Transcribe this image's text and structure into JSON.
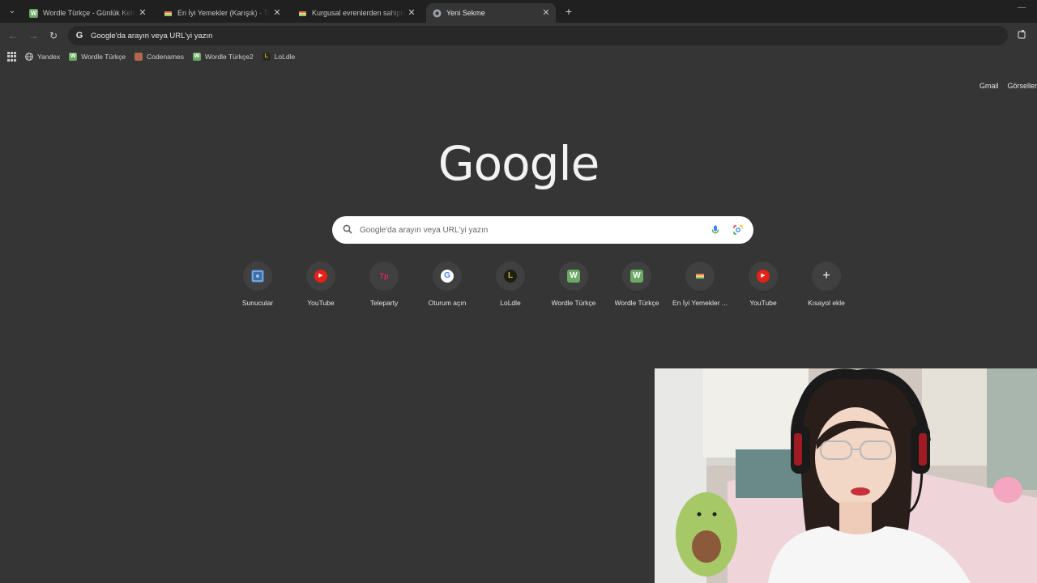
{
  "tabs": [
    {
      "title": "Wordle Türkçe - Günlük Kelime Oyunu",
      "fav": "W",
      "fav_color": "#6aaa64",
      "active": false
    },
    {
      "title": "En İyi Yemekler (Karışık) - Tier List",
      "fav": "",
      "fav_color": "#7a8a5a",
      "active": false
    },
    {
      "title": "Kurgusal evrenlerden sahiplenmek istediğiniz",
      "fav": "",
      "fav_color": "#7a8a5a",
      "active": false
    },
    {
      "title": "Yeni Sekme",
      "fav": "",
      "fav_color": "#8a8a8a",
      "active": true
    }
  ],
  "toolbar": {
    "address": "Google'da arayın veya URL'yi yazın"
  },
  "bookmarks": [
    {
      "label": "Yandex",
      "fav": "",
      "color": "#666"
    },
    {
      "label": "Wordle Türkçe",
      "fav": "W",
      "color": "#6aaa64"
    },
    {
      "label": "Codenames",
      "fav": "",
      "color": "#b0674b"
    },
    {
      "label": "Wordle Türkçe2",
      "fav": "W",
      "color": "#6aaa64"
    },
    {
      "label": "LoLdle",
      "fav": "L",
      "color": "#2a2a1a"
    }
  ],
  "toplinks": {
    "gmail": "Gmail",
    "images": "Görseller"
  },
  "logo": "Google",
  "search": {
    "placeholder": "Google'da arayın veya URL'yi yazın"
  },
  "shortcuts": [
    {
      "label": "Sunucular",
      "icon": "servers-icon",
      "color": "#3d6ea8",
      "glyph": ""
    },
    {
      "label": "YouTube",
      "icon": "youtube-icon",
      "color": "#e62117",
      "glyph": "▶"
    },
    {
      "label": "Teleparty",
      "icon": "teleparty-icon",
      "color": "#e0245e",
      "glyph": "Tp"
    },
    {
      "label": "Oturum açın",
      "icon": "google-icon",
      "color": "#ffffff",
      "glyph": "G"
    },
    {
      "label": "LoLdle",
      "icon": "loldle-icon",
      "color": "#1e1e12",
      "glyph": "L"
    },
    {
      "label": "Wordle Türkçe",
      "icon": "wordle-icon",
      "color": "#6aaa64",
      "glyph": "W"
    },
    {
      "label": "Wordle Türkçe",
      "icon": "wordle-icon",
      "color": "#6aaa64",
      "glyph": "W"
    },
    {
      "label": "En İyi Yemekler ...",
      "icon": "tierlist-icon",
      "color": "#7a8a5a",
      "glyph": ""
    },
    {
      "label": "YouTube",
      "icon": "youtube-icon",
      "color": "#e62117",
      "glyph": "▶"
    },
    {
      "label": "Kısayol ekle",
      "icon": "plus-icon",
      "color": "#404040",
      "glyph": "+"
    }
  ]
}
